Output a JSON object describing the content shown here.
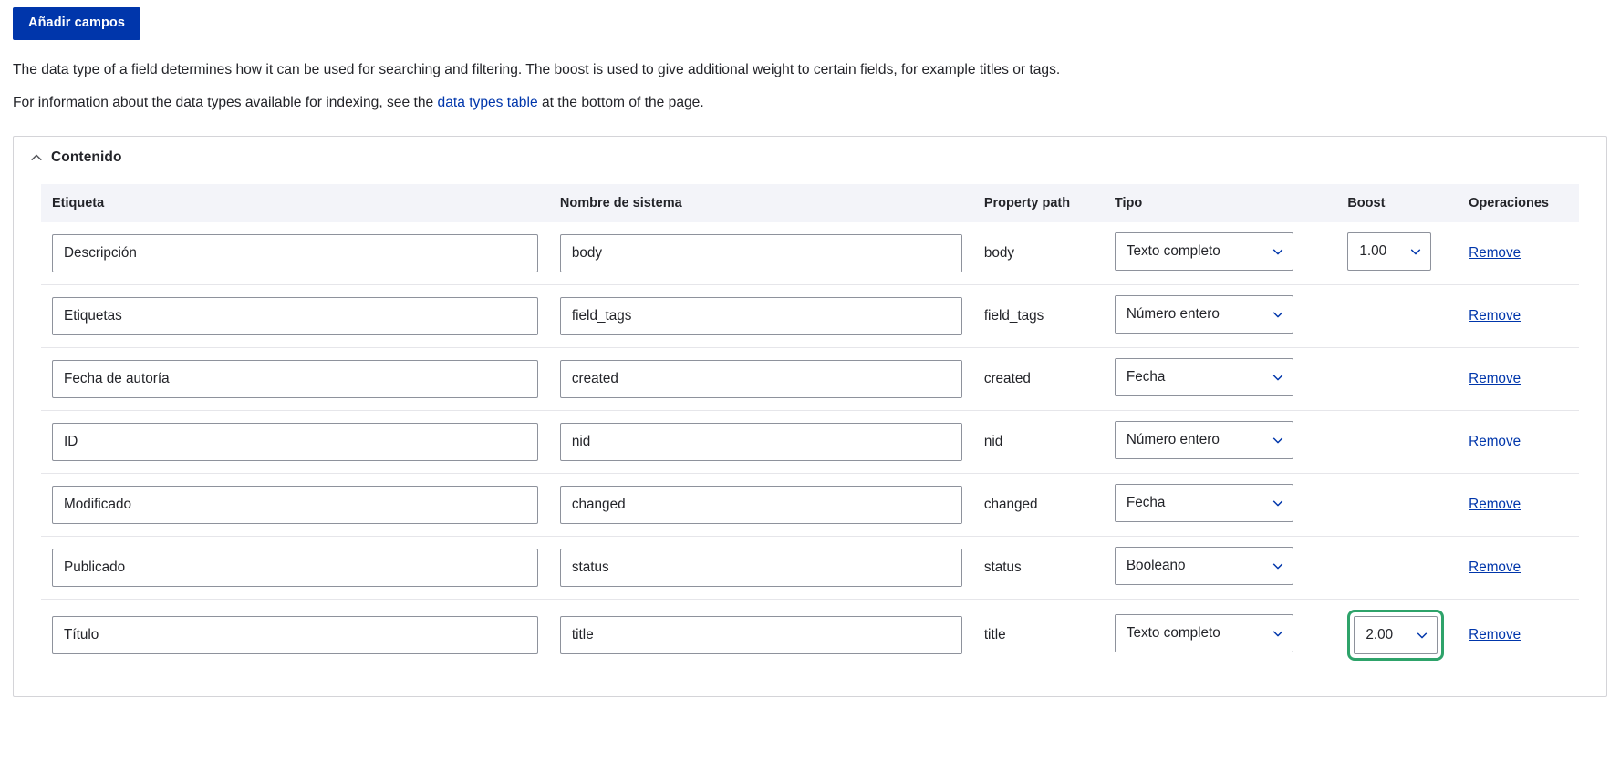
{
  "toolbar": {
    "add_fields_label": "Añadir campos"
  },
  "intro": {
    "line1": "The data type of a field determines how it can be used for searching and filtering. The boost is used to give additional weight to certain fields, for example titles or tags.",
    "line2_before": "For information about the data types available for indexing, see the",
    "line2_link": "data types table",
    "line2_after": "at the bottom of the page."
  },
  "section": {
    "title": "Contenido",
    "toggle_icon": "chevron-up-icon",
    "expanded": true
  },
  "table": {
    "columns": [
      "Etiqueta",
      "Nombre de sistema",
      "Property path",
      "Tipo",
      "Boost",
      "Operaciones"
    ],
    "remove_label": "Remove",
    "rows": [
      {
        "label": "Descripción",
        "system_name": "body",
        "property_path": "body",
        "type": "Texto completo",
        "boost": "1.00",
        "boost_visible": true,
        "boost_focused": false,
        "remove": "Remove"
      },
      {
        "label": "Etiquetas",
        "system_name": "field_tags",
        "property_path": "field_tags",
        "type": "Número entero",
        "boost": "",
        "boost_visible": false,
        "boost_focused": false,
        "remove": "Remove"
      },
      {
        "label": "Fecha de autoría",
        "system_name": "created",
        "property_path": "created",
        "type": "Fecha",
        "boost": "",
        "boost_visible": false,
        "boost_focused": false,
        "remove": "Remove"
      },
      {
        "label": "ID",
        "system_name": "nid",
        "property_path": "nid",
        "type": "Número entero",
        "boost": "",
        "boost_visible": false,
        "boost_focused": false,
        "remove": "Remove"
      },
      {
        "label": "Modificado",
        "system_name": "changed",
        "property_path": "changed",
        "type": "Fecha",
        "boost": "",
        "boost_visible": false,
        "boost_focused": false,
        "remove": "Remove"
      },
      {
        "label": "Publicado",
        "system_name": "status",
        "property_path": "status",
        "type": "Booleano",
        "boost": "",
        "boost_visible": false,
        "boost_focused": false,
        "remove": "Remove"
      },
      {
        "label": "Título",
        "system_name": "title",
        "property_path": "title",
        "type": "Texto completo",
        "boost": "2.00",
        "boost_visible": true,
        "boost_focused": true,
        "remove": "Remove"
      }
    ]
  },
  "colors": {
    "primary_button_bg": "#0036ab",
    "link": "#0036ab",
    "focus_ring": "#2ea36a",
    "table_header_bg": "#f3f4f9",
    "border": "#8e929c",
    "text": "#232429"
  }
}
